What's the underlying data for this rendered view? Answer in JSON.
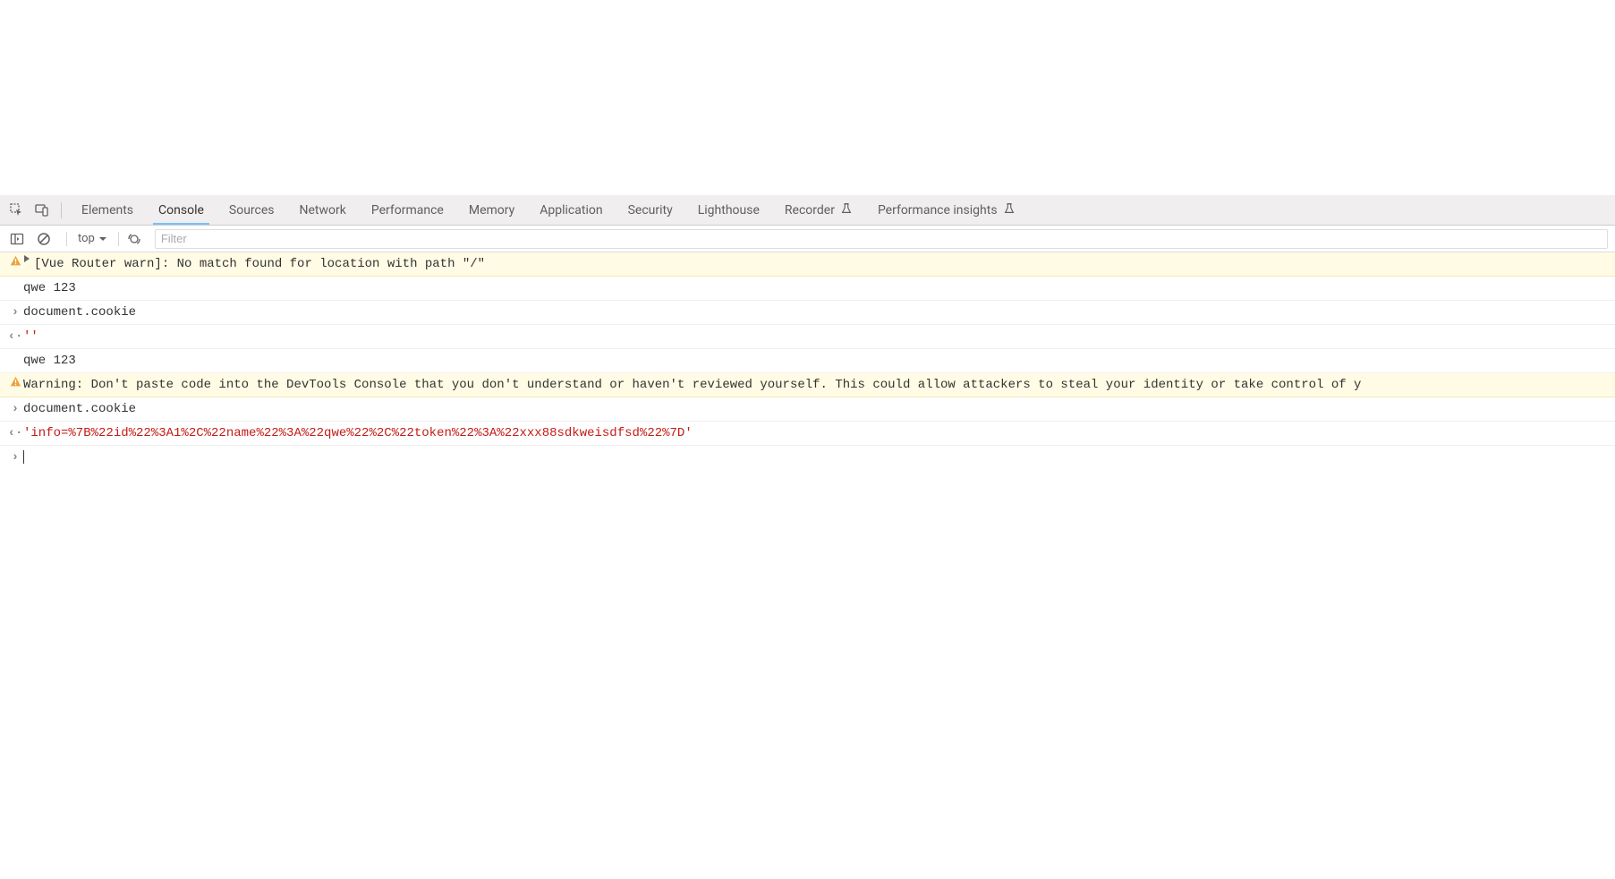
{
  "tabs": {
    "items": [
      {
        "label": "Elements"
      },
      {
        "label": "Console",
        "active": true
      },
      {
        "label": "Sources"
      },
      {
        "label": "Network"
      },
      {
        "label": "Performance"
      },
      {
        "label": "Memory"
      },
      {
        "label": "Application"
      },
      {
        "label": "Security"
      },
      {
        "label": "Lighthouse"
      },
      {
        "label": "Recorder",
        "badge": "experimental"
      },
      {
        "label": "Performance insights",
        "badge": "experimental"
      }
    ]
  },
  "toolbar": {
    "context": "top",
    "filter_placeholder": "Filter"
  },
  "console": {
    "rows": [
      {
        "type": "warn",
        "expandable": true,
        "text": "[Vue Router warn]: No match found for location with path \"/\""
      },
      {
        "type": "log",
        "text": "qwe 123"
      },
      {
        "type": "input",
        "text": "document.cookie"
      },
      {
        "type": "output",
        "text": "''"
      },
      {
        "type": "log",
        "text": "qwe 123"
      },
      {
        "type": "warn",
        "expandable": false,
        "text": "Warning: Don't paste code into the DevTools Console that you don't understand or haven't reviewed yourself. This could allow attackers to steal your identity or take control of y"
      },
      {
        "type": "input",
        "text": "document.cookie"
      },
      {
        "type": "output",
        "text": "'info=%7B%22id%22%3A1%2C%22name%22%3A%22qwe%22%2C%22token%22%3A%22xxx88sdkweisdfsd%22%7D'"
      }
    ]
  }
}
